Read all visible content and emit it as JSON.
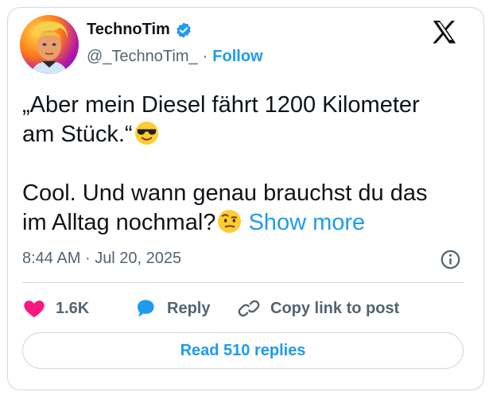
{
  "author": {
    "display_name": "TechnoTim",
    "handle": "@_TechnoTim_",
    "separator": "·",
    "follow_label": "Follow",
    "verified": true
  },
  "platform_icon": "x-logo-icon",
  "post": {
    "line1": "„Aber mein Diesel fährt 1200 Kilometer",
    "line2": "am Stück.“",
    "emoji1": "smiling-face-with-sunglasses-emoji",
    "line3": "Cool. Und wann genau brauchst du das",
    "line4": "im Alltag nochmal?",
    "emoji2": "face-with-raised-eyebrow-emoji",
    "show_more": "Show more"
  },
  "meta": {
    "time": "8:44 AM",
    "separator": "·",
    "date": "Jul 20, 2025"
  },
  "actions": {
    "like_count": "1.6K",
    "reply_label": "Reply",
    "copy_label": "Copy link to post"
  },
  "read_replies_label": "Read 510 replies",
  "colors": {
    "accent": "#1d9bf0",
    "like": "#f91880",
    "secondary_text": "#536471",
    "border": "#cfd9de"
  }
}
